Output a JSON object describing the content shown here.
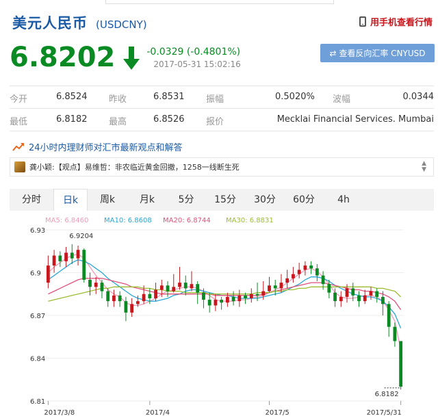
{
  "header": {
    "title": "美元人民币",
    "symbol": "(USDCNY)",
    "mobile_link": "用手机查看行情"
  },
  "quote": {
    "price": "6.8202",
    "change": "-0.0329 (-0.4801%)",
    "timestamp": "2017-05-31 15:02:16",
    "reverse_button": "⇄ 查看反向汇率 CNYUSD"
  },
  "stats": {
    "open_label": "今开",
    "open": "6.8524",
    "prev_close_label": "昨收",
    "prev_close": "6.8531",
    "amplitude_label": "振幅",
    "amplitude": "0.5020%",
    "range_label": "波幅",
    "range": "0.0344",
    "low_label": "最低",
    "low": "6.8182",
    "high_label": "最高",
    "high": "6.8526",
    "quote_label": "报价",
    "quote_source": "Mecklai Financial Services. Mumbai"
  },
  "news": {
    "header": "24小时内理财师对汇市最新观点和解答",
    "item": "龚小颖:【观点】易维哲：非农临近黄金回撤，1258一线断生死"
  },
  "tabs": [
    "分时",
    "日k",
    "周k",
    "月k",
    "5分",
    "15分",
    "30分",
    "60分",
    "4h"
  ],
  "active_tab": 1,
  "colors": {
    "accent": "#1a5aa5",
    "down": "#0a8a23",
    "up": "#c8161d",
    "ma5": "#f29bb8",
    "ma10": "#29a8d8",
    "ma20": "#e0507a",
    "ma30": "#9cbd32"
  },
  "chart_data": {
    "type": "line",
    "title": "",
    "legend": [
      {
        "name": "MA5",
        "value": "6.8460",
        "color": "#f29bb8"
      },
      {
        "name": "MA10",
        "value": "6.8608",
        "color": "#29a8d8"
      },
      {
        "name": "MA20",
        "value": "6.8744",
        "color": "#e0507a"
      },
      {
        "name": "MA30",
        "value": "6.8831",
        "color": "#9cbd32"
      }
    ],
    "y_ticks": [
      "6.93",
      "6.9",
      "6.87",
      "6.84",
      "6.81"
    ],
    "ylim": [
      6.81,
      6.93
    ],
    "x_ticks": [
      {
        "label": "2017/3/8",
        "index": 0
      },
      {
        "label": "2017/4",
        "index": 17
      },
      {
        "label": "2017/5",
        "index": 37
      },
      {
        "label": "2017/5/31",
        "index": 59
      }
    ],
    "annotations": [
      {
        "label": "6.9204",
        "index": 4,
        "value": 6.9204
      },
      {
        "label": "6.8182",
        "index": 59,
        "value": 6.8182
      }
    ],
    "candles": [
      [
        6.893,
        6.905,
        6.912,
        6.889
      ],
      [
        6.905,
        6.912,
        6.916,
        6.9
      ],
      [
        6.912,
        6.908,
        6.915,
        6.904
      ],
      [
        6.908,
        6.914,
        6.918,
        6.904
      ],
      [
        6.914,
        6.91,
        6.92,
        6.906
      ],
      [
        6.91,
        6.916,
        6.919,
        6.905
      ],
      [
        6.916,
        6.895,
        6.917,
        6.893
      ],
      [
        6.895,
        6.89,
        6.9,
        6.884
      ],
      [
        6.89,
        6.893,
        6.897,
        6.885
      ],
      [
        6.893,
        6.887,
        6.895,
        6.882
      ],
      [
        6.887,
        6.88,
        6.889,
        6.876
      ],
      [
        6.88,
        6.884,
        6.888,
        6.876
      ],
      [
        6.884,
        6.88,
        6.887,
        6.876
      ],
      [
        6.88,
        6.872,
        6.883,
        6.866
      ],
      [
        6.872,
        6.878,
        6.882,
        6.869
      ],
      [
        6.878,
        6.88,
        6.884,
        6.876
      ],
      [
        6.88,
        6.885,
        6.891,
        6.878
      ],
      [
        6.885,
        6.882,
        6.889,
        6.878
      ],
      [
        6.882,
        6.888,
        6.893,
        6.88
      ],
      [
        6.888,
        6.891,
        6.895,
        6.883
      ],
      [
        6.891,
        6.887,
        6.894,
        6.883
      ],
      [
        6.887,
        6.89,
        6.899,
        6.886
      ],
      [
        6.89,
        6.893,
        6.904,
        6.888
      ],
      [
        6.893,
        6.889,
        6.898,
        6.884
      ],
      [
        6.889,
        6.892,
        6.901,
        6.887
      ],
      [
        6.892,
        6.886,
        6.894,
        6.878
      ],
      [
        6.886,
        6.881,
        6.889,
        6.875
      ],
      [
        6.881,
        6.877,
        6.886,
        6.872
      ],
      [
        6.877,
        6.881,
        6.885,
        6.873
      ],
      [
        6.881,
        6.879,
        6.883,
        6.874
      ],
      [
        6.879,
        6.883,
        6.886,
        6.876
      ],
      [
        6.883,
        6.88,
        6.887,
        6.877
      ],
      [
        6.88,
        6.884,
        6.888,
        6.876
      ],
      [
        6.884,
        6.882,
        6.886,
        6.878
      ],
      [
        6.882,
        6.885,
        6.889,
        6.879
      ],
      [
        6.885,
        6.884,
        6.893,
        6.88
      ],
      [
        6.884,
        6.887,
        6.894,
        6.881
      ],
      [
        6.887,
        6.891,
        6.897,
        6.886
      ],
      [
        6.891,
        6.889,
        6.895,
        6.884
      ],
      [
        6.889,
        6.893,
        6.899,
        6.886
      ],
      [
        6.893,
        6.896,
        6.902,
        6.889
      ],
      [
        6.896,
        6.899,
        6.904,
        6.893
      ],
      [
        6.899,
        6.902,
        6.907,
        6.896
      ],
      [
        6.902,
        6.905,
        6.908,
        6.898
      ],
      [
        6.905,
        6.903,
        6.908,
        6.899
      ],
      [
        6.903,
        6.898,
        6.906,
        6.894
      ],
      [
        6.898,
        6.892,
        6.901,
        6.888
      ],
      [
        6.892,
        6.886,
        6.895,
        6.882
      ],
      [
        6.886,
        6.88,
        6.889,
        6.876
      ],
      [
        6.88,
        6.883,
        6.887,
        6.876
      ],
      [
        6.883,
        6.889,
        6.892,
        6.879
      ],
      [
        6.889,
        6.884,
        6.893,
        6.88
      ],
      [
        6.884,
        6.88,
        6.887,
        6.876
      ],
      [
        6.88,
        6.884,
        6.888,
        6.878
      ],
      [
        6.884,
        6.887,
        6.89,
        6.881
      ],
      [
        6.887,
        6.883,
        6.889,
        6.879
      ],
      [
        6.883,
        6.878,
        6.887,
        6.87
      ],
      [
        6.878,
        6.862,
        6.88,
        6.855
      ],
      [
        6.862,
        6.852,
        6.865,
        6.848
      ],
      [
        6.852,
        6.82,
        6.852,
        6.818
      ]
    ],
    "ma": [
      {
        "name": "MA5",
        "color": "#f29bb8",
        "values": [
          6.9,
          6.904,
          6.907,
          6.91,
          6.912,
          6.913,
          6.91,
          6.904,
          6.898,
          6.893,
          6.888,
          6.885,
          6.883,
          6.879,
          6.877,
          6.877,
          6.878,
          6.88,
          6.882,
          6.885,
          6.887,
          6.888,
          6.889,
          6.89,
          6.89,
          6.889,
          6.887,
          6.884,
          6.881,
          6.88,
          6.88,
          6.88,
          6.881,
          6.881,
          6.882,
          6.883,
          6.884,
          6.886,
          6.888,
          6.89,
          6.893,
          6.896,
          6.899,
          6.902,
          6.903,
          6.901,
          6.897,
          6.892,
          6.886,
          6.883,
          6.882,
          6.882,
          6.883,
          6.884,
          6.884,
          6.883,
          6.88,
          6.874,
          6.866,
          6.846
        ]
      },
      {
        "name": "MA10",
        "color": "#29a8d8",
        "values": [
          6.895,
          6.898,
          6.901,
          6.904,
          6.907,
          6.909,
          6.908,
          6.906,
          6.903,
          6.9,
          6.896,
          6.893,
          6.89,
          6.887,
          6.884,
          6.882,
          6.881,
          6.88,
          6.88,
          6.881,
          6.882,
          6.884,
          6.885,
          6.887,
          6.888,
          6.888,
          6.887,
          6.886,
          6.885,
          6.884,
          6.884,
          6.883,
          6.882,
          6.882,
          6.882,
          6.882,
          6.883,
          6.884,
          6.885,
          6.886,
          6.888,
          6.89,
          6.892,
          6.895,
          6.897,
          6.897,
          6.896,
          6.894,
          6.891,
          6.889,
          6.887,
          6.885,
          6.884,
          6.883,
          6.883,
          6.882,
          6.88,
          6.876,
          6.871,
          6.861
        ]
      },
      {
        "name": "MA20",
        "color": "#e0507a",
        "values": [
          6.885,
          6.887,
          6.889,
          6.891,
          6.893,
          6.895,
          6.896,
          6.896,
          6.896,
          6.896,
          6.895,
          6.894,
          6.893,
          6.892,
          6.89,
          6.889,
          6.888,
          6.887,
          6.886,
          6.885,
          6.885,
          6.885,
          6.885,
          6.885,
          6.885,
          6.885,
          6.885,
          6.885,
          6.884,
          6.884,
          6.884,
          6.884,
          6.884,
          6.884,
          6.884,
          6.884,
          6.885,
          6.886,
          6.887,
          6.888,
          6.889,
          6.89,
          6.891,
          6.892,
          6.893,
          6.893,
          6.893,
          6.892,
          6.891,
          6.89,
          6.889,
          6.888,
          6.888,
          6.887,
          6.887,
          6.886,
          6.885,
          6.883,
          6.88,
          6.874
        ]
      },
      {
        "name": "MA30",
        "color": "#9cbd32",
        "values": [
          6.88,
          6.881,
          6.882,
          6.883,
          6.884,
          6.885,
          6.886,
          6.887,
          6.888,
          6.889,
          6.889,
          6.89,
          6.89,
          6.89,
          6.89,
          6.89,
          6.889,
          6.889,
          6.888,
          6.888,
          6.887,
          6.887,
          6.887,
          6.886,
          6.886,
          6.886,
          6.886,
          6.885,
          6.885,
          6.885,
          6.885,
          6.885,
          6.885,
          6.885,
          6.885,
          6.886,
          6.886,
          6.886,
          6.887,
          6.887,
          6.888,
          6.888,
          6.889,
          6.889,
          6.89,
          6.89,
          6.89,
          6.89,
          6.89,
          6.89,
          6.89,
          6.89,
          6.89,
          6.89,
          6.89,
          6.889,
          6.889,
          6.888,
          6.887,
          6.883
        ]
      }
    ]
  },
  "bottom_strip": [
    "MA5",
    "MA10",
    "MA20"
  ]
}
